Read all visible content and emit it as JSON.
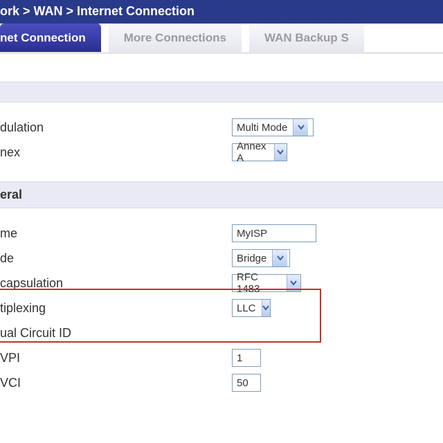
{
  "breadcrumb": {
    "p0": "ork",
    "sep": " > ",
    "p1": "WAN",
    "p2": "Internet Connection"
  },
  "tabs": {
    "t0": "net Connection",
    "t1": "More Connections",
    "t2": "WAN Backup S"
  },
  "section1": {
    "title": ""
  },
  "section2": {
    "title": "eral"
  },
  "labels": {
    "modulation": "dulation",
    "annex": "nex",
    "name": "me",
    "mode": "de",
    "encapsulation": "capsulation",
    "multiplex": "tiplexing",
    "vcircuit": "ual Circuit ID",
    "vpi": "VPI",
    "vci": "VCI"
  },
  "fields": {
    "modulation": "Multi Mode",
    "annex": "Annex A",
    "name": "MyISP",
    "mode": "Bridge",
    "encapsulation": "RFC 1483",
    "multiplex": "LLC",
    "vpi": "1",
    "vci": "50"
  }
}
